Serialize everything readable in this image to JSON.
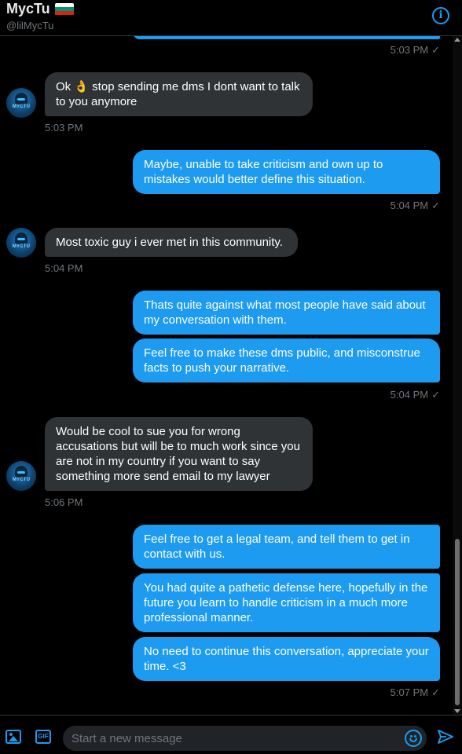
{
  "header": {
    "name": "MycTu",
    "handle": "@lilMycTu",
    "flag_colors": [
      "#ffffff",
      "#00966e",
      "#d62612"
    ],
    "info_icon": "info-icon"
  },
  "thread": {
    "messages": [
      {
        "dir": "out",
        "lines": [
          "",
          ""
        ],
        "time": "5:03 PM",
        "check": "✓"
      },
      {
        "dir": "in",
        "text": "Ok 👌 stop sending me dms I dont want to talk to you anymore",
        "time": "5:03 PM"
      },
      {
        "dir": "out",
        "text": "Maybe, unable to take criticism and own up to mistakes would better define this situation.",
        "time": "5:04 PM",
        "check": "✓"
      },
      {
        "dir": "in",
        "text": "Most toxic guy i ever met in this community.",
        "time": "5:04 PM"
      },
      {
        "dir": "out",
        "text": "Thats quite against what most people have said about my conversation with them."
      },
      {
        "dir": "out",
        "text": "Feel free to make these dms public, and misconstrue facts to push your narrative.",
        "time": "5:04 PM",
        "check": "✓"
      },
      {
        "dir": "in",
        "text": "Would be cool to sue you for wrong accusations but will be to much work since you are not in my country if you want to say something more send email to my lawyer",
        "time": "5:06 PM"
      },
      {
        "dir": "out",
        "text": "Feel free to get a legal team, and tell them to get in contact with us."
      },
      {
        "dir": "out",
        "text": "You had quite a pathetic defense here, hopefully in the future you learn to handle criticism in a much more professional manner."
      },
      {
        "dir": "out",
        "text": "No need to continue this conversation, appreciate your time. <3",
        "time": "5:07 PM",
        "check": "✓"
      }
    ]
  },
  "compose": {
    "placeholder": "Start a new message",
    "gif_label": "GIF"
  },
  "avatar": {
    "tag": "MYCTU"
  },
  "colors": {
    "accent": "#1d9bf0",
    "incoming": "#2f3336",
    "background": "#000000"
  }
}
